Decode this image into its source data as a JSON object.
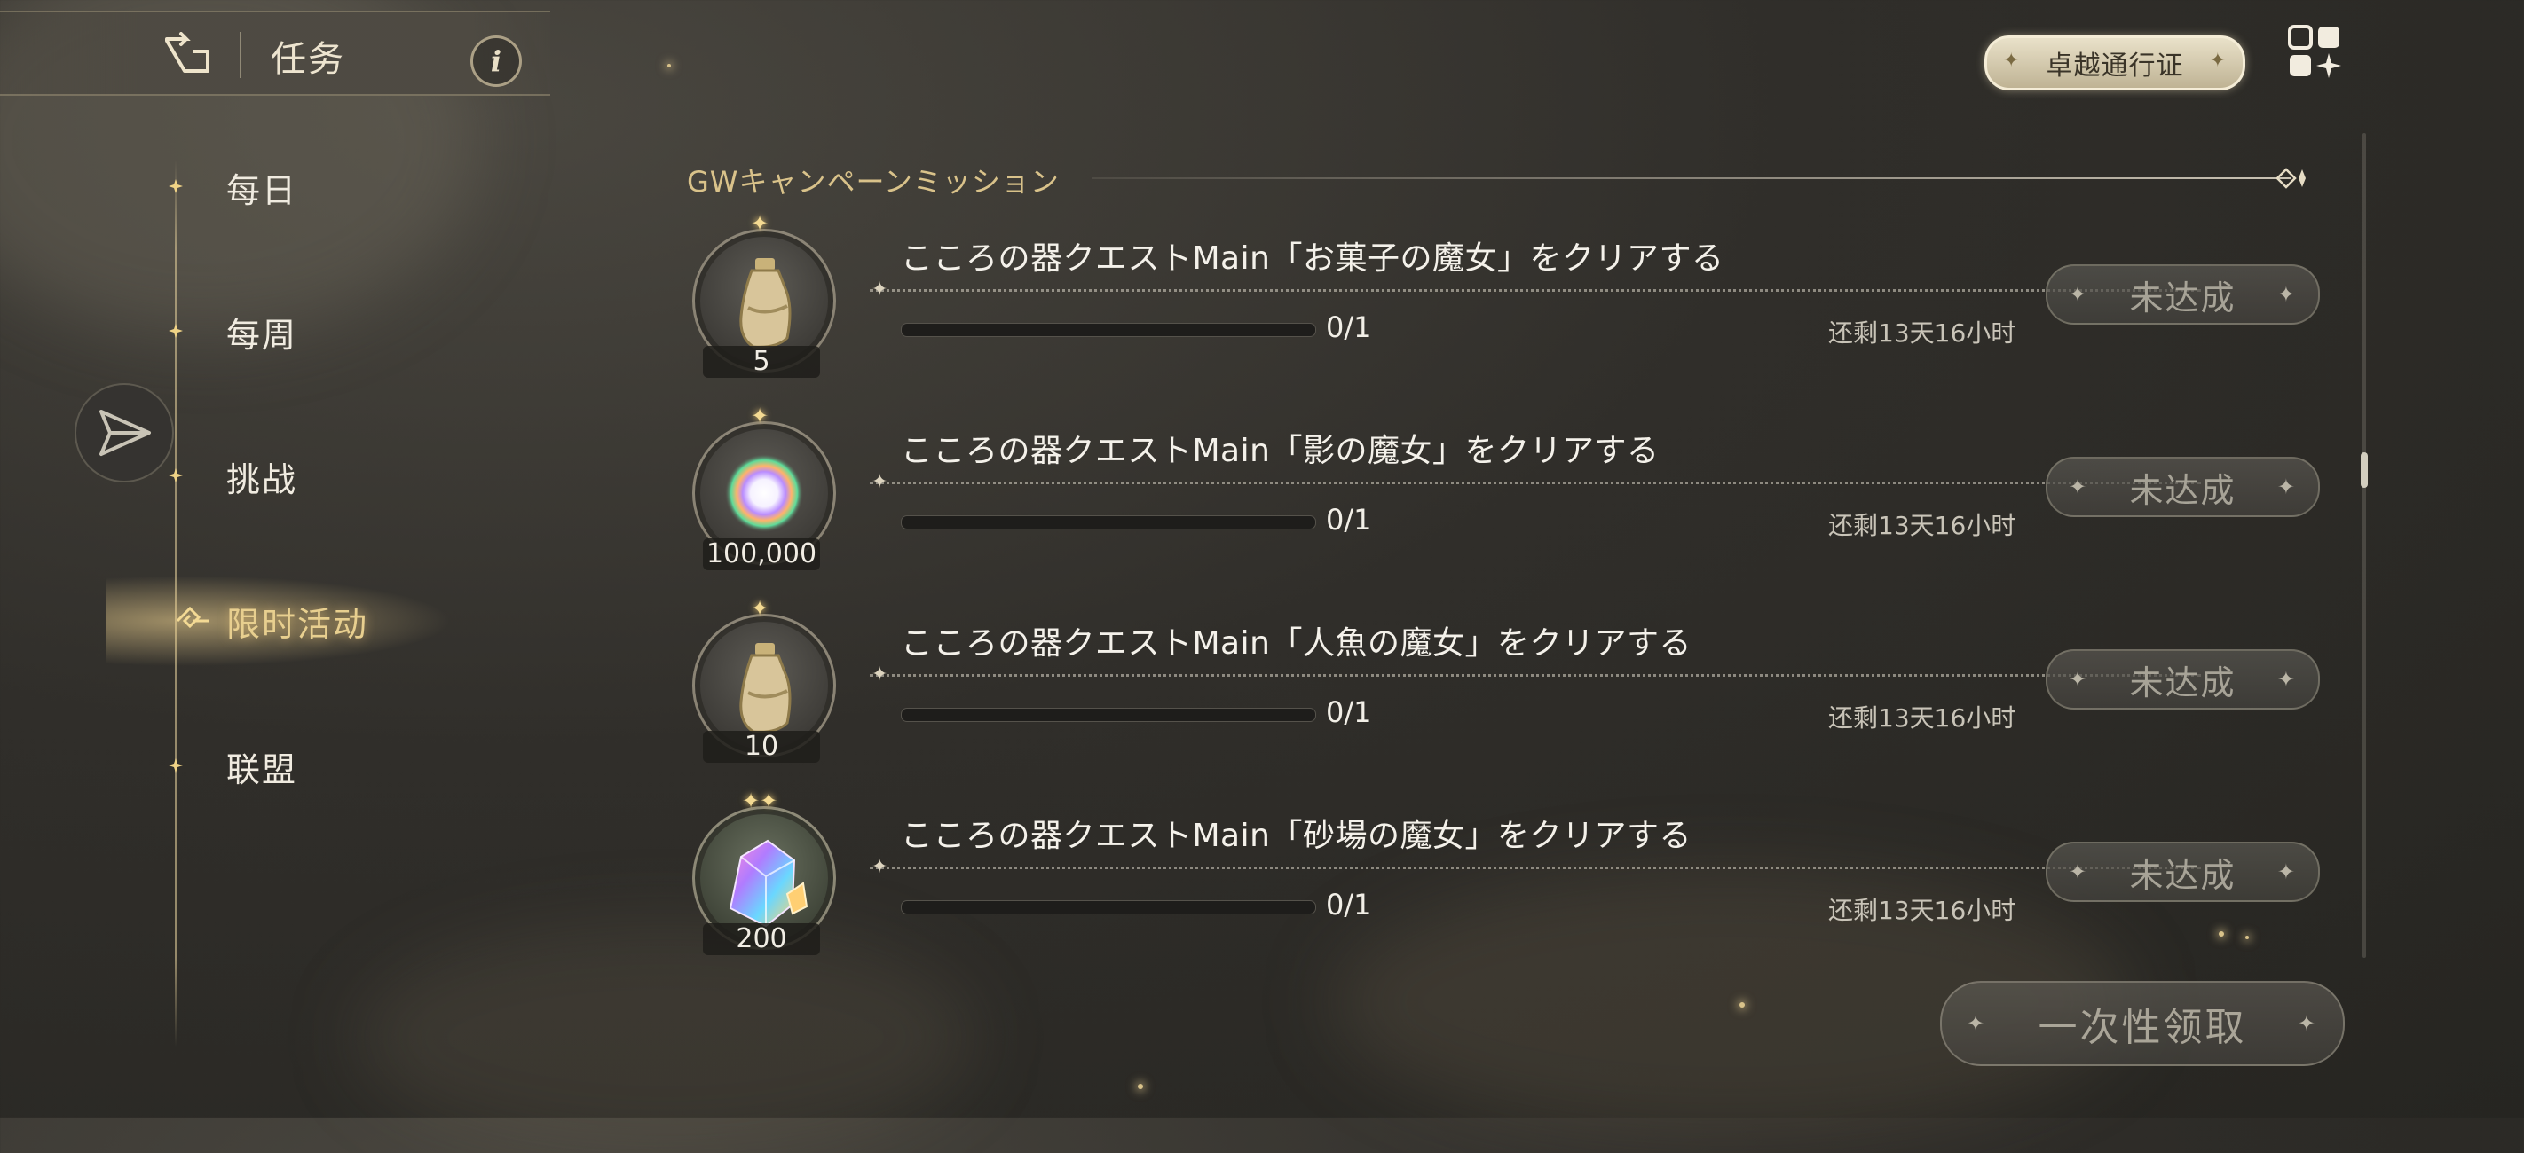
{
  "header": {
    "title": "任务",
    "info_label": "i"
  },
  "pass_button": {
    "label": "卓越通行证"
  },
  "nav": {
    "items": [
      {
        "label": "每日",
        "active": false
      },
      {
        "label": "每周",
        "active": false
      },
      {
        "label": "挑战",
        "active": false
      },
      {
        "label": "限时活动",
        "active": true
      },
      {
        "label": "联盟",
        "active": false
      }
    ]
  },
  "section": {
    "title": "GWキャンペーンミッション"
  },
  "tasks": [
    {
      "name": "こころの器クエストMain「お菓子の魔女」をクリアする",
      "reward_icon": "potion-bottle-icon",
      "reward_count": "5",
      "progress": "0/1",
      "progress_fraction": 0,
      "time_left": "还剩13天16小时",
      "status": "未达成"
    },
    {
      "name": "こころの器クエストMain「影の魔女」をクリアする",
      "reward_icon": "rainbow-orb-icon",
      "reward_count": "100,000",
      "progress": "0/1",
      "progress_fraction": 0,
      "time_left": "还剩13天16小时",
      "status": "未达成"
    },
    {
      "name": "こころの器クエストMain「人魚の魔女」をクリアする",
      "reward_icon": "potion-bottle-icon",
      "reward_count": "10",
      "progress": "0/1",
      "progress_fraction": 0,
      "time_left": "还剩13天16小时",
      "status": "未达成"
    },
    {
      "name": "こころの器クエストMain「砂場の魔女」をクリアする",
      "reward_icon": "rainbow-crystal-icon",
      "reward_count": "200",
      "progress": "0/1",
      "progress_fraction": 0,
      "time_left": "还剩13天16小时",
      "status": "未达成"
    }
  ],
  "claim_all_button": {
    "label": "一次性领取"
  },
  "colors": {
    "accent_gold": "#d9c28a",
    "background": "#302e2a",
    "disabled_text": "#a7a397"
  }
}
